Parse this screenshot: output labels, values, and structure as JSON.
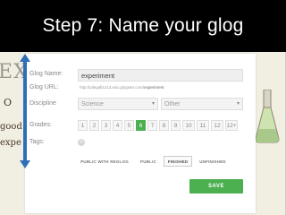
{
  "slide": {
    "title": "Step 7: Name your glog"
  },
  "background": {
    "word_ex": "EX",
    "word_o": "O",
    "word_good": "good",
    "word_expe": "expe"
  },
  "form": {
    "glog_name": {
      "label": "Glog Name:",
      "value": "experiment"
    },
    "glog_url": {
      "label": "Glog URL:",
      "prefix": "http://pilegall1213.edu.glogster.com/",
      "slug": "experiment"
    },
    "discipline": {
      "label": "Discipline",
      "value": "Science",
      "other_placeholder": "Other"
    },
    "grades": {
      "label": "Grades:",
      "items": [
        "1",
        "2",
        "3",
        "4",
        "5",
        "6",
        "7",
        "8",
        "9",
        "10",
        "11",
        "12",
        "12+"
      ],
      "selected": "6"
    },
    "tags": {
      "label": "Tags:",
      "add_symbol": "+"
    },
    "visibility": {
      "options": [
        "PUBLIC WITH REGLOG",
        "PUBLIC",
        "FINISHED",
        "UNFINISHED"
      ],
      "selected": "FINISHED"
    },
    "save_label": "SAVE"
  },
  "colors": {
    "accent": "#4caf50",
    "arrow": "#2f6fb5"
  }
}
